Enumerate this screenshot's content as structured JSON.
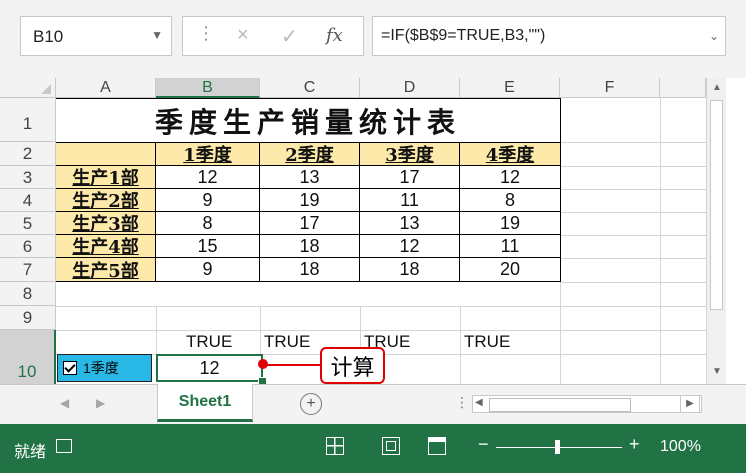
{
  "formula_bar": {
    "name_box": "B10",
    "cancel_glyph": "×",
    "enter_glyph": "✓",
    "fx_label": "fx",
    "formula": "=IF($B$9=TRUE,B3,\"\")"
  },
  "columns": [
    "A",
    "B",
    "C",
    "D",
    "E",
    "F"
  ],
  "rows": [
    "1",
    "2",
    "3",
    "4",
    "5",
    "6",
    "7",
    "8",
    "9",
    "10"
  ],
  "selected_column": "B",
  "selected_row": "10",
  "sheet": {
    "title": "季度生产销量统计表",
    "quarter_headers": [
      "1季度",
      "2季度",
      "3季度",
      "4季度"
    ],
    "departments": [
      {
        "name": "生产1部",
        "values": [
          "12",
          "13",
          "17",
          "12"
        ]
      },
      {
        "name": "生产2部",
        "values": [
          "9",
          "19",
          "11",
          "8"
        ]
      },
      {
        "name": "生产3部",
        "values": [
          "8",
          "17",
          "13",
          "19"
        ]
      },
      {
        "name": "生产4部",
        "values": [
          "15",
          "18",
          "12",
          "11"
        ]
      },
      {
        "name": "生产5部",
        "values": [
          "9",
          "18",
          "18",
          "20"
        ]
      }
    ],
    "row9_values": [
      "TRUE",
      "TRUE",
      "TRUE",
      "TRUE"
    ],
    "checkbox_label": "1季度",
    "checkbox_checked": true,
    "selected_cell_value": "12"
  },
  "callout": {
    "text": "计算",
    "color": "#e00000"
  },
  "tabs": {
    "sheet_name": "Sheet1",
    "add_glyph": "+"
  },
  "status_bar": {
    "ready": "就绪",
    "zoom": "100%",
    "accent": "#217346"
  }
}
